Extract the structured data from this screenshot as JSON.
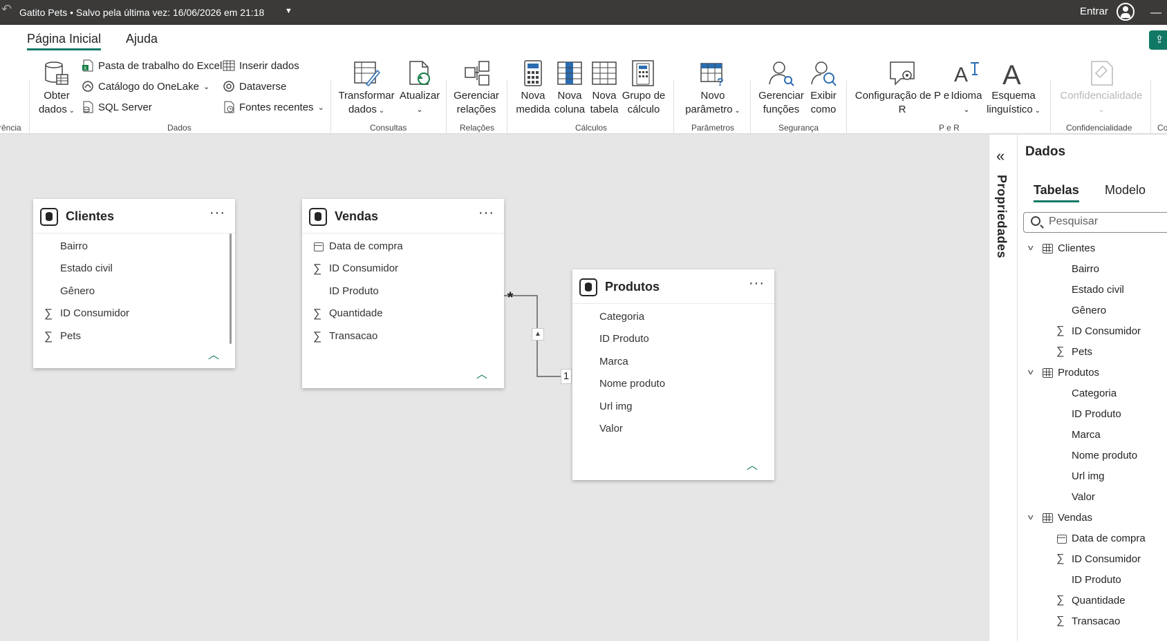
{
  "titlebar": {
    "title": "Gatito Pets • Salvo pela última vez: 16/06/2026 em 21:18",
    "signin": "Entrar"
  },
  "ribbon": {
    "tabs": [
      "Página Inicial",
      "Ajuda"
    ],
    "cut_left_label": "rência",
    "cut_right_label": "Co",
    "dados": {
      "obter_line1": "Obter",
      "obter_line2": "dados",
      "excel": "Pasta de trabalho do Excel",
      "onelake": "Catálogo do OneLake",
      "sql": "SQL Server",
      "inserir": "Inserir dados",
      "dataverse": "Dataverse",
      "fontes": "Fontes recentes",
      "group": "Dados"
    },
    "consultas": {
      "transformar_l1": "Transformar",
      "transformar_l2": "dados",
      "atualizar": "Atualizar",
      "group": "Consultas"
    },
    "relacoes": {
      "l1": "Gerenciar",
      "l2": "relações",
      "group": "Relações"
    },
    "calculos": {
      "nova_medida_l1": "Nova",
      "nova_medida_l2": "medida",
      "nova_coluna_l1": "Nova",
      "nova_coluna_l2": "coluna",
      "nova_tabela_l1": "Nova",
      "nova_tabela_l2": "tabela",
      "grupo_l1": "Grupo de",
      "grupo_l2": "cálculo",
      "group": "Cálculos"
    },
    "parametros": {
      "l1": "Novo",
      "l2": "parâmetro",
      "group": "Parâmetros"
    },
    "seguranca": {
      "gerenciar_l1": "Gerenciar",
      "gerenciar_l2": "funções",
      "exibir_l1": "Exibir",
      "exibir_l2": "como",
      "group": "Segurança"
    },
    "per": {
      "config_l1": "Configuração de P e",
      "config_l2": "R",
      "idioma": "Idioma",
      "esquema_l1": "Esquema",
      "esquema_l2": "linguístico",
      "group": "P e R"
    },
    "confidencialidade": {
      "btn": "Confidencialidade",
      "group": "Confidencialidade"
    }
  },
  "tables": {
    "clientes": {
      "name": "Clientes",
      "fields": [
        {
          "label": "Bairro",
          "icon": "none"
        },
        {
          "label": "Estado civil",
          "icon": "none"
        },
        {
          "label": "Gênero",
          "icon": "none"
        },
        {
          "label": "ID Consumidor",
          "icon": "sigma"
        },
        {
          "label": "Pets",
          "icon": "sigma"
        }
      ]
    },
    "vendas": {
      "name": "Vendas",
      "fields": [
        {
          "label": "Data de compra",
          "icon": "calendar"
        },
        {
          "label": "ID Consumidor",
          "icon": "sigma"
        },
        {
          "label": "ID Produto",
          "icon": "none"
        },
        {
          "label": "Quantidade",
          "icon": "sigma"
        },
        {
          "label": "Transacao",
          "icon": "sigma"
        }
      ]
    },
    "produtos": {
      "name": "Produtos",
      "fields": [
        {
          "label": "Categoria",
          "icon": "none"
        },
        {
          "label": "ID Produto",
          "icon": "none"
        },
        {
          "label": "Marca",
          "icon": "none"
        },
        {
          "label": "Nome produto",
          "icon": "none"
        },
        {
          "label": "Url img",
          "icon": "none"
        },
        {
          "label": "Valor",
          "icon": "none"
        }
      ]
    }
  },
  "relationship": {
    "many": "*",
    "one": "1"
  },
  "properties_pane": {
    "label": "Propriedades"
  },
  "data_pane": {
    "title": "Dados",
    "tabs": [
      "Tabelas",
      "Modelo"
    ],
    "search_placeholder": "Pesquisar",
    "tree": [
      {
        "table": "Clientes",
        "fields": [
          {
            "label": "Bairro",
            "icon": "none"
          },
          {
            "label": "Estado civil",
            "icon": "none"
          },
          {
            "label": "Gênero",
            "icon": "none"
          },
          {
            "label": "ID Consumidor",
            "icon": "sigma"
          },
          {
            "label": "Pets",
            "icon": "sigma"
          }
        ]
      },
      {
        "table": "Produtos",
        "fields": [
          {
            "label": "Categoria",
            "icon": "none"
          },
          {
            "label": "ID Produto",
            "icon": "none"
          },
          {
            "label": "Marca",
            "icon": "none"
          },
          {
            "label": "Nome produto",
            "icon": "none"
          },
          {
            "label": "Url img",
            "icon": "none"
          },
          {
            "label": "Valor",
            "icon": "none"
          }
        ]
      },
      {
        "table": "Vendas",
        "fields": [
          {
            "label": "Data de compra",
            "icon": "calendar"
          },
          {
            "label": "ID Consumidor",
            "icon": "sigma"
          },
          {
            "label": "ID Produto",
            "icon": "none"
          },
          {
            "label": "Quantidade",
            "icon": "sigma"
          },
          {
            "label": "Transacao",
            "icon": "sigma"
          }
        ]
      }
    ]
  }
}
